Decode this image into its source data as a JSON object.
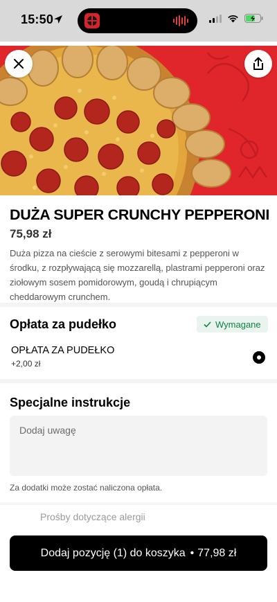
{
  "status_bar": {
    "time": "15:50"
  },
  "product": {
    "title": "DUŻA SUPER CRUNCHY PEPPERONI",
    "price": "75,98 zł",
    "description": "Duża pizza na cieście z serowymi bitesami z pepperoni w środku, z rozpływającą się mozzarellą, plastrami pepperoni oraz ziołowym sosem pomidorowym, goudą i chrupiącym cheddarowym crunchem."
  },
  "box_fee": {
    "section_title": "Opłata za pudełko",
    "required_label": "Wymagane",
    "option_label": "OPŁATA ZA PUDEŁKO",
    "option_price": "+2,00 zł",
    "selected": true
  },
  "instructions": {
    "section_title": "Specjalne instrukcje",
    "placeholder": "Dodaj uwagę",
    "value": "",
    "hint": "Za dodatki może zostać naliczona opłata."
  },
  "allergy": {
    "label": "Prośby dotyczące alergii"
  },
  "cart_button": {
    "label": "Dodaj pozycję (1) do koszyka",
    "separator": "•",
    "total": "77,98 zł"
  },
  "colors": {
    "hero_red": "#e1262b",
    "required_green": "#0e8345",
    "required_bg": "#eaf4ee",
    "button_bg": "#000000"
  },
  "icons": {
    "close": "close-icon",
    "share": "share-icon",
    "check": "check-icon",
    "location": "location-arrow-icon"
  }
}
